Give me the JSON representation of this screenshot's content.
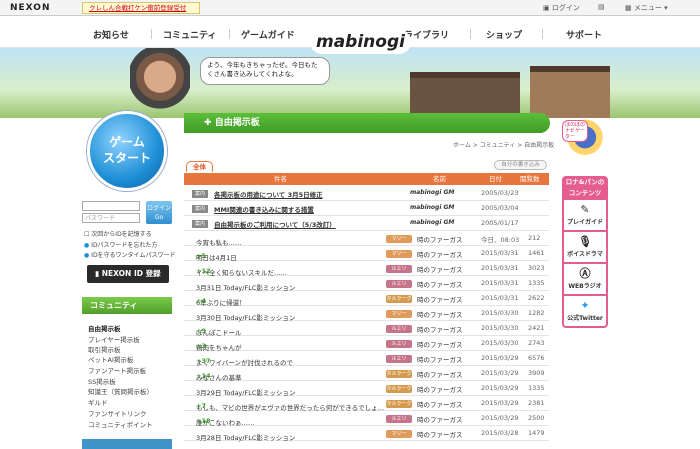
{
  "topbar": {
    "logo": "NEXON",
    "promo": "クレしん合戦打ケン衝前登録受付中！",
    "login": "ログイン",
    "menu": "メニュー ▾"
  },
  "nav": {
    "items": [
      "お知らせ",
      "コミュニティ",
      "ゲームガイド",
      "ライブラリ",
      "ショップ",
      "サポート"
    ],
    "logo": "mabinogi"
  },
  "hero": {
    "speech": "よう、今年もきちゃったぜ。今日もたくさん書き込みしてくれよな。"
  },
  "left": {
    "start": "ゲーム\nスタート",
    "id_placeholder": "",
    "pw_placeholder": "パスワード",
    "login_btn": "ログインGo",
    "remember": "次回からIDを記憶する",
    "forgot": "IDパスワードを忘れた方",
    "otp": "IDを守るワンタイムパスワード",
    "nexon_id": "NEXON ID 登録",
    "community": "コミュニティ",
    "menu": [
      "自由掲示板",
      "プレイヤー掲示板",
      "取引掲示板",
      "ペットAI掲示板",
      "ファンアート掲示板",
      "SS掲示板",
      "知識王（質問掲示板）",
      "ギルド",
      "ファンサイトリンク",
      "コミュニティポイント"
    ]
  },
  "board": {
    "title": "自由掲示板",
    "breadcrumb": "ホーム > コミュニティ > 自由掲示板",
    "tab_all": "全体",
    "my_posts": "自分の書き込み",
    "headers": {
      "subject": "件名",
      "name": "名前",
      "date": "日付",
      "views": "閲覧数"
    },
    "notices": [
      {
        "tag": "案内",
        "subject": "各掲示板の用途について 3月5日修正",
        "name": "mabinogi GM",
        "date": "2005/03/23"
      },
      {
        "tag": "案内",
        "subject": "MMI関連の書き込みに関する措置",
        "name": "mabinogi GM",
        "date": "2005/03/04"
      },
      {
        "tag": "案内",
        "subject": "自由掲示板のご利用について（5/3改訂）",
        "name": "mabinogi GM",
        "date": "2005/01/17"
      }
    ],
    "rows": [
      {
        "subject": "今宵も私も……",
        "comments": "",
        "cat": "マリー",
        "name": "時のファーガス",
        "date": "今日、08:03",
        "views": "212"
      },
      {
        "subject": "明日は4月1日",
        "comments": "+5",
        "cat": "マリー",
        "name": "時のファーガス",
        "date": "2015/03/31",
        "views": "1461"
      },
      {
        "subject": "イベ全く知らないスキルだ……",
        "comments": "+12",
        "cat": "ルエリ",
        "name": "時のファーガス",
        "date": "2015/03/31",
        "views": "3023"
      },
      {
        "subject": "3月31日 Today/FLC影ミッション",
        "comments": "",
        "cat": "ルエリ",
        "name": "時のファーガス",
        "date": "2015/03/31",
        "views": "1335"
      },
      {
        "subject": "6年ぶりに帰還！",
        "comments": "+4",
        "cat": "タルラーク",
        "name": "時のファーガス",
        "date": "2015/03/31",
        "views": "2622"
      },
      {
        "subject": "3月30日 Today/FLC影ミッション",
        "comments": "",
        "cat": "マリー",
        "name": "時のファーガス",
        "date": "2015/03/30",
        "views": "1282"
      },
      {
        "subject": "ぽんぽこドール",
        "comments": "+9",
        "cat": "ルエリ",
        "name": "時のファーガス",
        "date": "2015/03/30",
        "views": "2421"
      },
      {
        "subject": "鶏肉をちゃんが",
        "comments": "+3",
        "cat": "ルエリ",
        "name": "時のファーガス",
        "date": "2015/03/30",
        "views": "2743"
      },
      {
        "subject": "よくワイバーンが討伐されるので",
        "comments": "+37",
        "cat": "ルエリ",
        "name": "時のファーガス",
        "date": "2015/03/29",
        "views": "6576"
      },
      {
        "subject": "みなさんの基準",
        "comments": "+14",
        "cat": "タルラーク",
        "name": "時のファーガス",
        "date": "2015/03/29",
        "views": "3909"
      },
      {
        "subject": "3月29日 Today/FLC影ミッション",
        "comments": "",
        "cat": "タルラーク",
        "name": "時のファーガス",
        "date": "2015/03/29",
        "views": "1335"
      },
      {
        "subject": "もしも、マビの世界がエヴァの世界だったら何ができるでしょ…",
        "comments": "+7",
        "cat": "タルラーク",
        "name": "時のファーガス",
        "date": "2015/03/29",
        "views": "2381"
      },
      {
        "subject": "誰かこないわぁ……",
        "comments": "+18",
        "cat": "ルエリ",
        "name": "時のファーガス",
        "date": "2015/03/29",
        "views": "2500"
      },
      {
        "subject": "3月28日 Today/FLC影ミッション",
        "comments": "",
        "cat": "マリー",
        "name": "時のファーガス",
        "date": "2015/03/28",
        "views": "1479"
      }
    ]
  },
  "right": {
    "header": "ロナ&パンの コンテンツ",
    "bubble": "ほのぼの ナビゲーター",
    "items": [
      "プレイガイド",
      "ボイスドラマ",
      "WEBラジオ",
      "公式Twitter"
    ]
  },
  "colors": {
    "マリー": "#e09b5a",
    "ルエリ": "#c6748a",
    "タルラーク": "#d59a4e"
  }
}
